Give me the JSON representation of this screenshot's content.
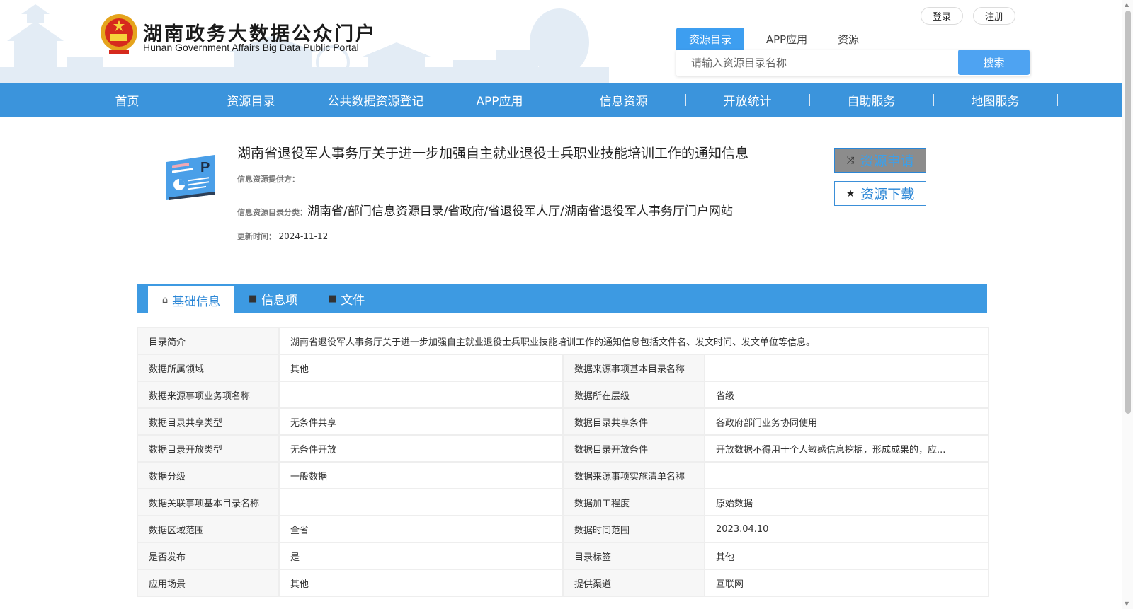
{
  "header": {
    "logo_cn": "湖南政务大数据公众门户",
    "logo_en": "Hunan Government Affairs Big Data Public Portal",
    "login_label": "登录",
    "register_label": "注册",
    "search_tabs": [
      {
        "label": "资源目录",
        "active": true
      },
      {
        "label": "APP应用",
        "active": false
      },
      {
        "label": "资源",
        "active": false
      }
    ],
    "search_placeholder": "请输入资源目录名称",
    "search_button": "搜索"
  },
  "nav": {
    "items": [
      {
        "label": "首页"
      },
      {
        "label": "资源目录"
      },
      {
        "label": "公共数据资源登记"
      },
      {
        "label": "APP应用"
      },
      {
        "label": "信息资源"
      },
      {
        "label": "开放统计"
      },
      {
        "label": "自助服务"
      },
      {
        "label": "地图服务"
      }
    ]
  },
  "detail": {
    "title": "湖南省退役军人事务厅关于进一步加强自主就业退役士兵职业技能培训工作的通知信息",
    "provider_label": "信息资源提供方：",
    "provider_value": "",
    "category_label": "信息资源目录分类：",
    "category_value": "湖南省/部门信息资源目录/省政府/省退役军人厅/湖南省退役军人事务厅门户网站",
    "updated_label": "更新时间：",
    "updated_value": "2024-11-12",
    "apply_button": "资源申请",
    "download_button": "资源下载",
    "apply_icon": "shuffle-icon",
    "download_icon": "star-icon"
  },
  "tabs": [
    {
      "label": "基础信息",
      "icon": "home-icon",
      "active": true
    },
    {
      "label": "信息项",
      "icon": "folder-icon",
      "active": false
    },
    {
      "label": "文件",
      "icon": "folder-icon",
      "active": false
    }
  ],
  "info": {
    "intro_label": "目录简介",
    "intro_value": "湖南省退役军人事务厅关于进一步加强自主就业退役士兵职业技能培训工作的通知信息包括文件名、发文时间、发文单位等信息。",
    "rows": [
      {
        "l1": "数据所属领域",
        "v1": "其他",
        "l2": "数据来源事项基本目录名称",
        "v2": ""
      },
      {
        "l1": "数据来源事项业务项名称",
        "v1": "",
        "l2": "数据所在层级",
        "v2": "省级"
      },
      {
        "l1": "数据目录共享类型",
        "v1": "无条件共享",
        "l2": "数据目录共享条件",
        "v2": "各政府部门业务协同使用"
      },
      {
        "l1": "数据目录开放类型",
        "v1": "无条件开放",
        "l2": "数据目录开放条件",
        "v2": "开放数据不得用于个人敏感信息挖掘，形成成果的，应..."
      },
      {
        "l1": "数据分级",
        "v1": "一般数据",
        "l2": "数据来源事项实施清单名称",
        "v2": ""
      },
      {
        "l1": "数据关联事项基本目录名称",
        "v1": "",
        "l2": "数据加工程度",
        "v2": "原始数据"
      },
      {
        "l1": "数据区域范围",
        "v1": "全省",
        "l2": "数据时间范围",
        "v2": "2023.04.10"
      },
      {
        "l1": "是否发布",
        "v1": "是",
        "l2": "目录标签",
        "v2": "其他"
      },
      {
        "l1": "应用场景",
        "v1": "其他",
        "l2": "提供渠道",
        "v2": "互联网"
      }
    ]
  },
  "colors": {
    "primary": "#3b94dc",
    "accent": "#2a86d6",
    "search_button": "#4ea3f2"
  }
}
